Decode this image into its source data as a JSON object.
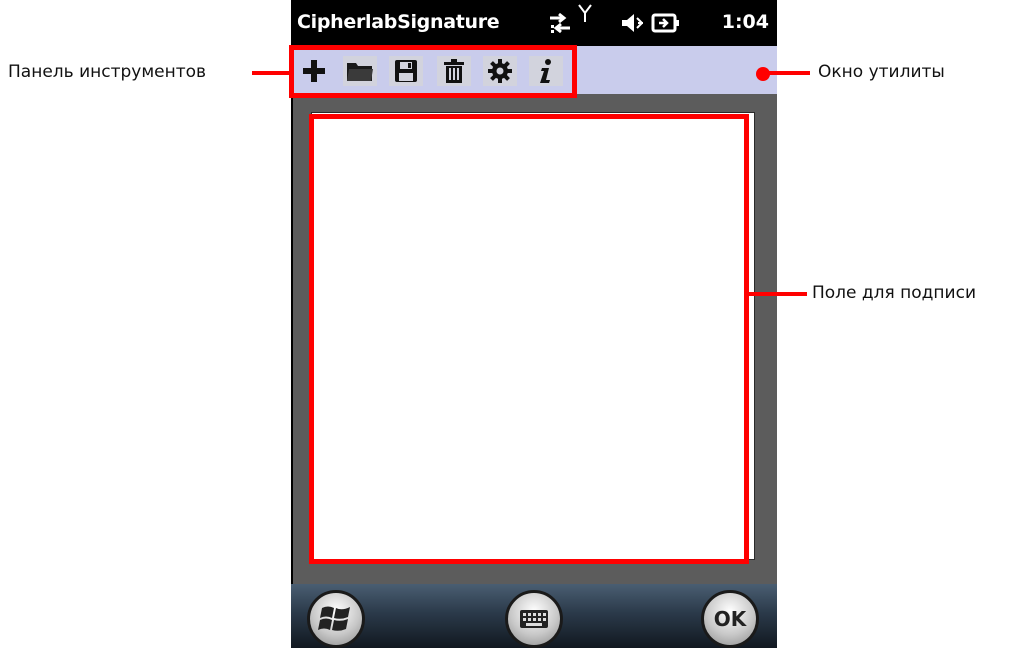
{
  "app": {
    "title": "CipherlabSignature",
    "clock": "1:04",
    "ok_label": "OK"
  },
  "status_icons": [
    "sync-arrows-icon",
    "signal-antenna-icon",
    "speaker-muted-icon",
    "battery-charging-icon"
  ],
  "toolbar": {
    "buttons": [
      {
        "name": "new",
        "icon": "plus-icon"
      },
      {
        "name": "open",
        "icon": "folder-icon"
      },
      {
        "name": "save",
        "icon": "floppy-disk-icon"
      },
      {
        "name": "delete",
        "icon": "trash-icon"
      },
      {
        "name": "settings",
        "icon": "gear-icon"
      },
      {
        "name": "info",
        "icon": "info-icon"
      }
    ]
  },
  "bottom_bar": {
    "buttons": [
      "windows-start-icon",
      "keyboard-icon",
      "ok-button"
    ]
  },
  "annotations": {
    "toolbar_label": "Панель инструментов",
    "utility_label": "Окно утилиты",
    "signature_label": "Поле для подписи"
  },
  "colors": {
    "annotation": "#ff0000",
    "toolbar_bg": "#c9ccec",
    "workspace_bg": "#5c5c5c"
  }
}
